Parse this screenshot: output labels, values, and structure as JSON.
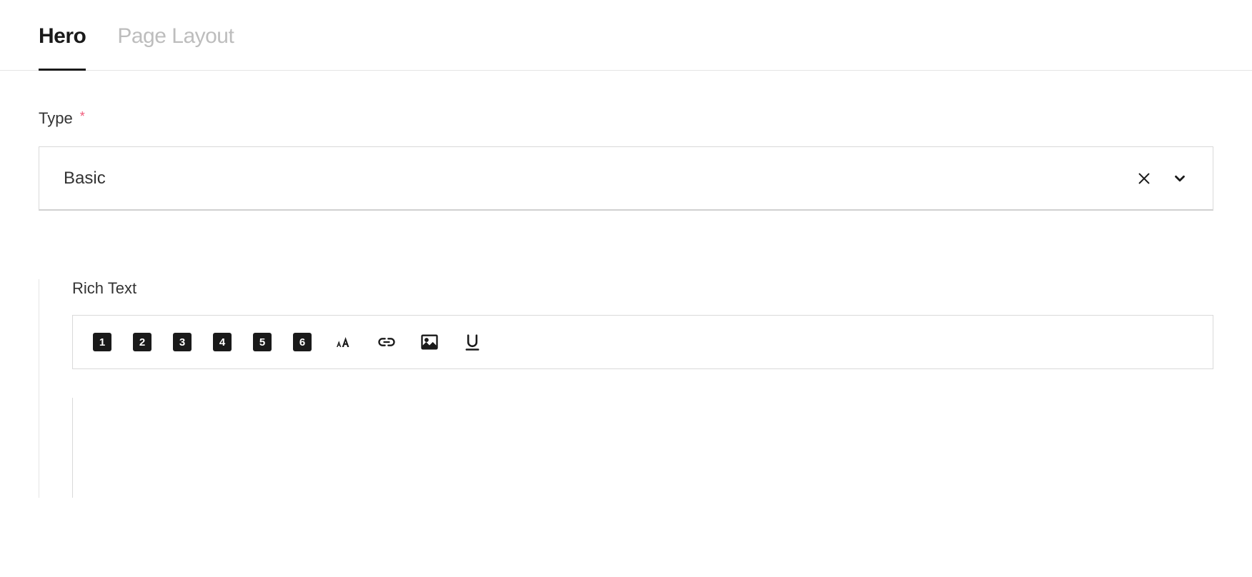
{
  "tabs": [
    {
      "label": "Hero",
      "active": true
    },
    {
      "label": "Page Layout",
      "active": false
    }
  ],
  "typeField": {
    "label": "Type",
    "required": true,
    "value": "Basic"
  },
  "richText": {
    "label": "Rich Text",
    "headingButtons": [
      "1",
      "2",
      "3",
      "4",
      "5",
      "6"
    ]
  }
}
